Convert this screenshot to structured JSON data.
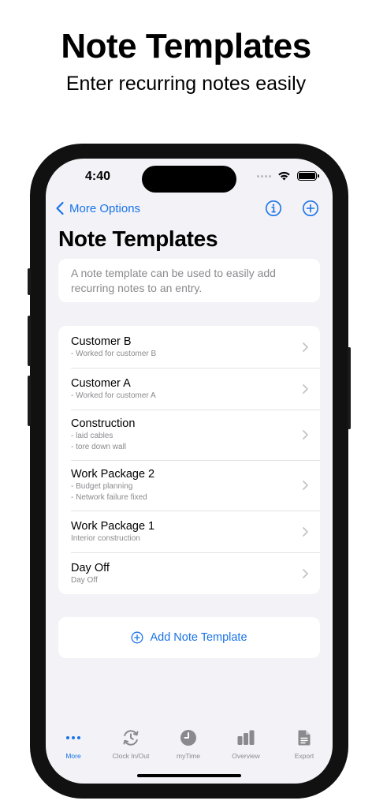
{
  "promo": {
    "title": "Note Templates",
    "subtitle": "Enter recurring notes easily"
  },
  "status_bar": {
    "time": "4:40",
    "icons": [
      "signal-dots-icon",
      "wifi-icon",
      "battery-icon"
    ]
  },
  "nav": {
    "back_label": "More Options",
    "back_icon": "chevron-left-icon",
    "right_icons": [
      "info-circle-icon",
      "plus-circle-icon"
    ]
  },
  "page": {
    "title": "Note Templates",
    "description": "A note template can be used to easily add recurring notes to an entry."
  },
  "templates": [
    {
      "title": "Customer B",
      "lines": [
        "- Worked for customer B"
      ]
    },
    {
      "title": "Customer A",
      "lines": [
        "- Worked for customer A"
      ]
    },
    {
      "title": "Construction",
      "lines": [
        "- laid cables",
        "- tore down wall"
      ]
    },
    {
      "title": "Work Package 2",
      "lines": [
        "- Budget planning",
        "- Network failure fixed"
      ]
    },
    {
      "title": "Work Package 1",
      "lines": [
        "Interior construction"
      ]
    },
    {
      "title": "Day Off",
      "lines": [
        "Day Off"
      ]
    }
  ],
  "add_button": {
    "label": "Add Note Template",
    "icon": "plus-circle-icon"
  },
  "tabbar": [
    {
      "label": "More",
      "icon": "ellipsis-icon",
      "active": true
    },
    {
      "label": "Clock In/Out",
      "icon": "clock-arrows-icon",
      "active": false
    },
    {
      "label": "myTime",
      "icon": "clock-filled-icon",
      "active": false
    },
    {
      "label": "Overview",
      "icon": "bar-chart-icon",
      "active": false
    },
    {
      "label": "Export",
      "icon": "document-icon",
      "active": false
    }
  ],
  "colors": {
    "accent": "#1a73e8",
    "background": "#f2f2f7",
    "secondary_text": "#8a8a8e",
    "device_frame": "#111111"
  }
}
